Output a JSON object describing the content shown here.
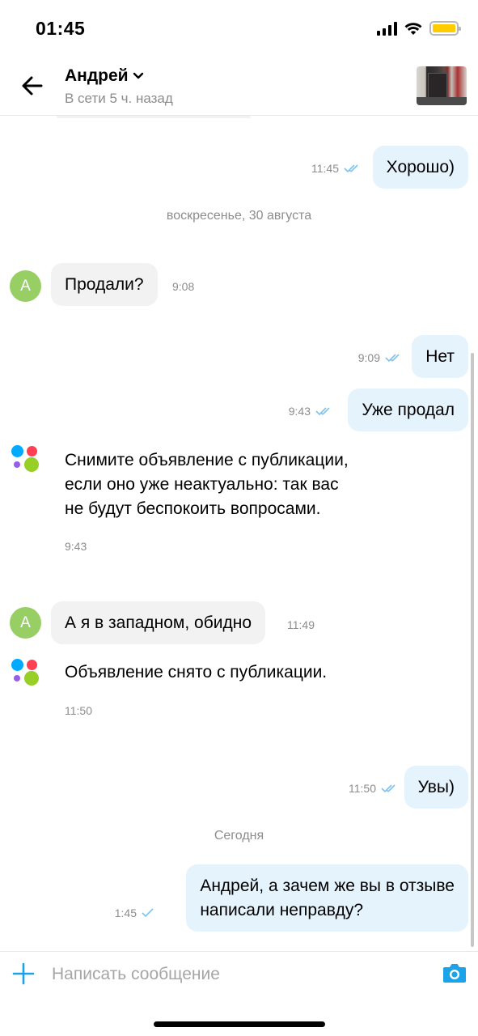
{
  "status_bar": {
    "time": "01:45",
    "battery_color": "#ffcc00"
  },
  "header": {
    "contact_name": "Андрей",
    "contact_status": "В сети 5 ч. назад",
    "icons": {
      "back": "back-arrow-icon",
      "chevron": "chevron-down-icon",
      "listing": "listing-thumbnail"
    }
  },
  "messages": {
    "m1": {
      "text": "Хорошо)",
      "time": "11:45",
      "read": true
    },
    "date1": "воскресенье, 30 августа",
    "m2": {
      "avatar": "А",
      "text": "Продали?",
      "time": "9:08"
    },
    "m3": {
      "text": "Нет",
      "time": "9:09",
      "read": true
    },
    "m4": {
      "text": "Уже продал",
      "time": "9:43",
      "read": true
    },
    "sys1": {
      "lines": [
        "Снимите объявление с публикации,",
        "если оно уже неактуально: так вас",
        "не будут беспокоить вопросами."
      ],
      "time": "9:43"
    },
    "m5": {
      "avatar": "А",
      "text": "А я в западном, обидно",
      "time": "11:49"
    },
    "sys2": {
      "lines": [
        "Объявление снято с публикации."
      ],
      "time": "11:50"
    },
    "m6": {
      "text": "Увы)",
      "time": "11:50",
      "read": true
    },
    "date2": "Сегодня",
    "m7": {
      "lines": [
        "Андрей, а зачем же вы в отзыве",
        "написали неправду?"
      ],
      "time": "1:45",
      "read": false
    }
  },
  "composer": {
    "placeholder": "Написать сообщение"
  },
  "colors": {
    "accent": "#1aa3e8",
    "out_bubble": "#e5f3fd",
    "in_bubble": "#f2f2f2",
    "avatar": "#97cf65",
    "check": "#7fc3ec"
  }
}
